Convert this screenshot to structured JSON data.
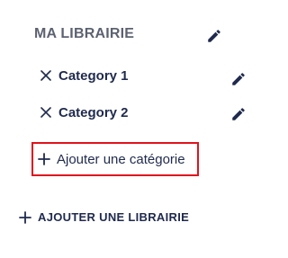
{
  "library": {
    "title": "MA LIBRAIRIE",
    "edit_icon": "pencil-icon"
  },
  "categories": [
    {
      "label": "Category 1",
      "remove_icon": "close-icon",
      "edit_icon": "pencil-icon"
    },
    {
      "label": "Category 2",
      "remove_icon": "close-icon",
      "edit_icon": "pencil-icon"
    }
  ],
  "add_category": {
    "label": "Ajouter une catégorie",
    "icon": "plus-icon",
    "highlight_color": "#e0121c"
  },
  "add_library": {
    "label": "AJOUTER UNE LIBRAIRIE",
    "icon": "plus-icon"
  },
  "colors": {
    "text": "#1f2a4d",
    "title": "#5d6270"
  }
}
